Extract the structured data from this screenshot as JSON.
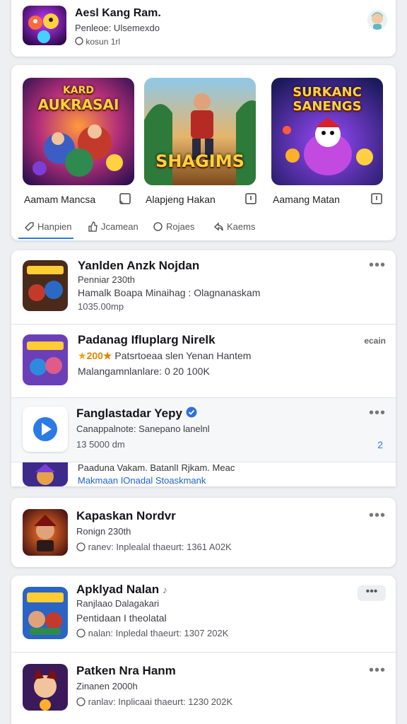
{
  "header": {
    "title": "Aesl Kang Ram.",
    "subtitle": "Penleoe: Ulsemexdo",
    "meta": "kosun 1rl"
  },
  "featured": {
    "games": [
      {
        "art_title": "AUKRASAI",
        "art_top": "KARD",
        "label": "Aamam Mancsa"
      },
      {
        "art_title": "SHAGIMS",
        "art_top": "",
        "label": "Alapjeng Hakan"
      },
      {
        "art_title": "SANENGS",
        "art_top": "SURKANC",
        "label": "Aamang Matan"
      }
    ],
    "tabs": [
      {
        "label": "Hanpien",
        "icon": "tag-icon"
      },
      {
        "label": "Jcamean",
        "icon": "thumb-up-icon"
      },
      {
        "label": "Rojaes",
        "icon": "tag-icon"
      },
      {
        "label": "Kaems",
        "icon": "share-icon"
      }
    ]
  },
  "feed": [
    {
      "title": "Yanlden Anzk Nojdan",
      "line1": "Penniar 230th",
      "line2": "Hamalk Boapa Minaihag : Olagnanaskam",
      "line3": "1035.00mp",
      "menu": "•••"
    },
    {
      "title": "Padanag Ifluplarg Nirelk",
      "rating": "200★",
      "line1": "Patsrtoeaa slen Yenan Hantem",
      "line2": "Malangamnlanlare: 0 20 100K",
      "menu": "ecain"
    },
    {
      "title": "Fanglastadar Yepy",
      "line1": "Canappalnote: Sanepano lanelnl",
      "line2": "13 5000 dm",
      "badge": "2",
      "menu": "•••"
    },
    {
      "line1": "Paaduna Vakam. BatanlI Rjkam. Meac",
      "link": "Makmaan IOnadal Stoaskmank"
    }
  ],
  "cards": [
    {
      "title": "Kapaskan Nordvr",
      "line1": "Ronign 230th",
      "meta": "ranev: Inplealal thaeurt: 1361 A02K"
    },
    {
      "title": "Apklyad Nalan",
      "line1": "Ranjlaao Dalagakari",
      "line2": "Pentidaan I theolatal",
      "meta": "nalan: Inpledal thaeurt: 1307 202K"
    },
    {
      "title": "Patken Nra Hanm",
      "line1": "Zinanen 2000h",
      "meta": "ranlav: Inplicaai thaeurt: 1230 202K"
    }
  ],
  "colors": {
    "accent": "#2a7be4",
    "verified": "#2f6fe0",
    "link": "#1d63c9",
    "star": "#f5a300",
    "background": "#eeeff3"
  }
}
